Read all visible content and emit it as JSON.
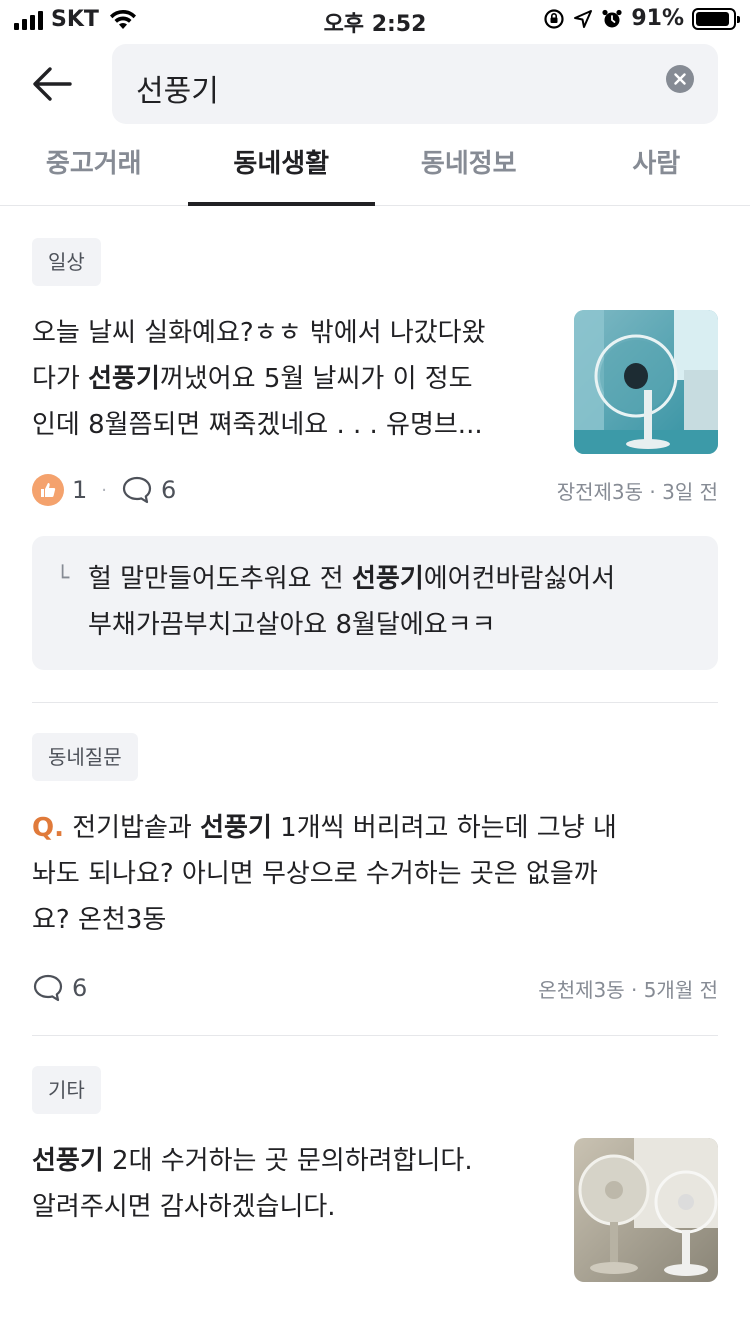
{
  "status_bar": {
    "carrier": "SKT",
    "time": "오후 2:52",
    "battery": "91%"
  },
  "search": {
    "query": "선풍기"
  },
  "tabs": [
    {
      "label": "중고거래",
      "active": false
    },
    {
      "label": "동네생활",
      "active": true
    },
    {
      "label": "동네정보",
      "active": false
    },
    {
      "label": "사람",
      "active": false
    }
  ],
  "posts": [
    {
      "category": "일상",
      "text_line1": "오늘 날씨 실화예요?ㅎㅎ 밖에서 나갔다왔",
      "text_line2_pre": "다가 ",
      "text_line2_keyword": "선풍기",
      "text_line2_post": "꺼냈어요 5월 날씨가 이 정도",
      "text_line3": "인데 8월쯤되면 쪄죽겠네요 . . . 유명브...",
      "likes": "1",
      "comments": "6",
      "location": "장전제3동",
      "time": "3일 전",
      "thumbnail": "fan-photo-1",
      "comment": {
        "pre": "헐 말만들어도추워요 전 ",
        "keyword": "선풍기",
        "post_line1": "에어컨바람싫어서",
        "line2": "부채가끔부치고살아요 8월달에요ㅋㅋ"
      }
    },
    {
      "category": "동네질문",
      "q_label": "Q.",
      "text_line1_pre": " 전기밥솥과 ",
      "text_line1_keyword": "선풍기",
      "text_line1_post": " 1개씩 버리려고 하는데 그냥 내",
      "text_line2": "놔도 되나요? 아니면 무상으로 수거하는 곳은 없을까",
      "text_line3": "요? 온천3동",
      "comments": "6",
      "location": "온천제3동",
      "time": "5개월 전"
    },
    {
      "category": "기타",
      "text_line1_keyword": "선풍기",
      "text_line1_post": " 2대 수거하는 곳 문의하려합니다.",
      "text_line2": "알려주시면 감사하겠습니다.",
      "thumbnail": "fan-photo-2"
    }
  ]
}
